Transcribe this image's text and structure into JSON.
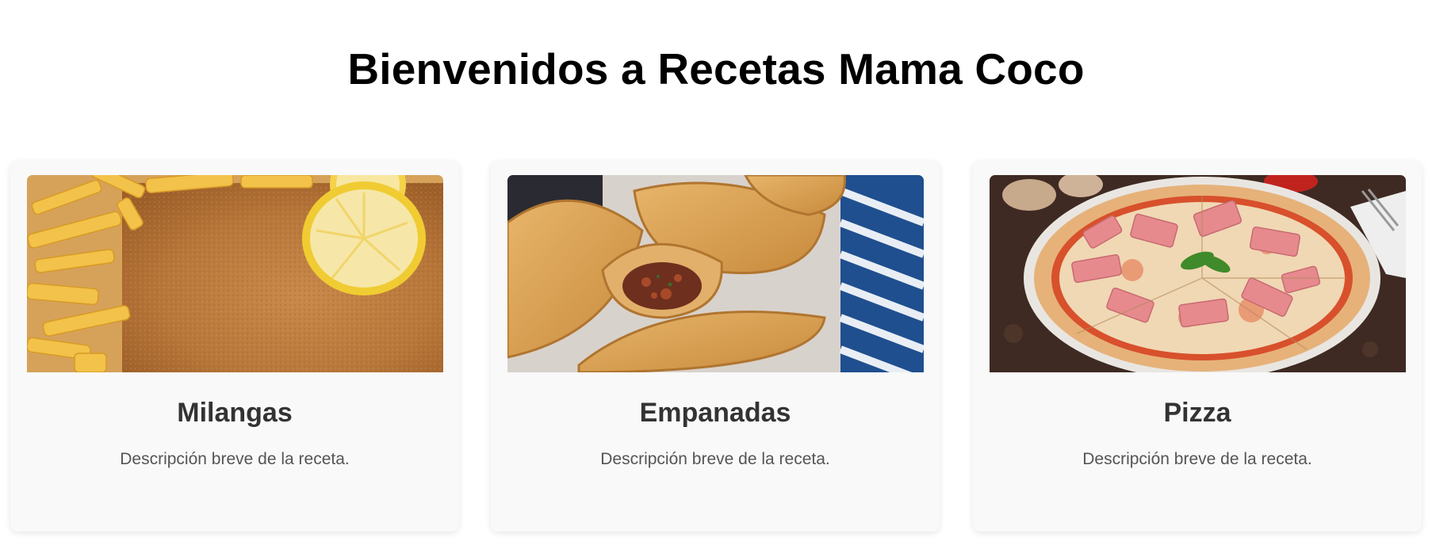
{
  "page": {
    "title": "Bienvenidos a Recetas Mama Coco"
  },
  "recipes": [
    {
      "title": "Milangas",
      "description": "Descripción breve de la receta.",
      "image_subject": "milanesa-with-fries-and-lemon"
    },
    {
      "title": "Empanadas",
      "description": "Descripción breve de la receta.",
      "image_subject": "empanadas-on-blue-cloth"
    },
    {
      "title": "Pizza",
      "description": "Descripción breve de la receta.",
      "image_subject": "ham-pizza-on-wooden-table"
    }
  ],
  "colors": {
    "background": "#ffffff",
    "card_background": "#f9f9f9",
    "title_text": "#000000",
    "card_title_text": "#333333",
    "description_text": "#555555"
  }
}
